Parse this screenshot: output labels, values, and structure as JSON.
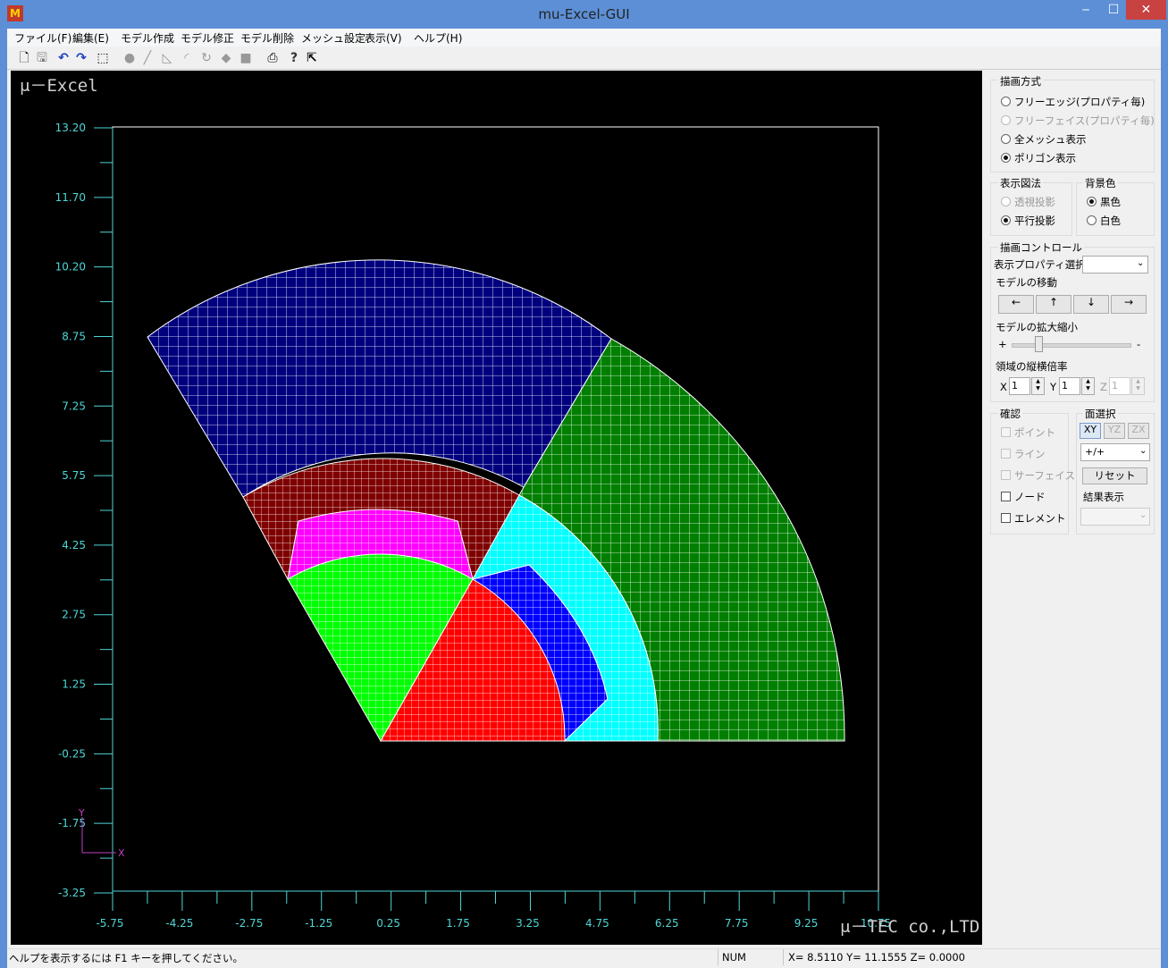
{
  "window": {
    "title": "mu-Excel-GUI",
    "app_icon": "mu-app-icon",
    "min": "‒",
    "max": "☐",
    "close": "✕"
  },
  "menu": [
    "ファイル(F)",
    "編集(E)",
    "モデル作成",
    "モデル修正",
    "モデル削除",
    "メッシュ設定",
    "表示(V)",
    "ヘルプ(H)"
  ],
  "toolbar": [
    "new-file-icon",
    "save-icon",
    "undo-icon",
    "redo-icon",
    "select-rect-icon",
    "point-icon",
    "line-icon",
    "arc-icon",
    "arc2-icon",
    "rotate-icon",
    "surface-icon",
    "fill-icon",
    "print-icon",
    "help-icon",
    "context-help-icon"
  ],
  "viewport": {
    "logo": "μ－Excel",
    "footer": "μ－TEC co.,LTD",
    "axis_x": "X",
    "axis_y": "Y",
    "y_ticks": [
      "13.20",
      "11.70",
      "10.20",
      "8.75",
      "7.25",
      "5.75",
      "4.25",
      "2.75",
      "1.25",
      "-0.25",
      "-1.75",
      "-3.25"
    ],
    "x_ticks": [
      "-5.75",
      "-4.25",
      "-2.75",
      "-1.25",
      "0.25",
      "1.75",
      "3.25",
      "4.75",
      "6.25",
      "7.75",
      "9.25",
      "10.75"
    ],
    "colors": {
      "background": "#000000",
      "axis": "#4fd6d6",
      "mesh": "#ffffff",
      "navy": "#00007f",
      "green": "#007f00",
      "maroon": "#7f0000",
      "magenta": "#ff00ff",
      "lime": "#00ff00",
      "red": "#ff0000",
      "cyan": "#00ffff",
      "blue": "#0000ff"
    }
  },
  "panel": {
    "draw_mode": {
      "title": "描画方式",
      "options": [
        "フリーエッジ(プロパティ毎)",
        "フリーフェイス(プロパティ毎)",
        "全メッシュ表示",
        "ポリゴン表示"
      ],
      "selected": "ポリゴン表示"
    },
    "projection": {
      "title": "表示図法",
      "options": [
        "透視投影",
        "平行投影"
      ],
      "selected": "平行投影"
    },
    "bg": {
      "title": "背景色",
      "options": [
        "黒色",
        "白色"
      ],
      "selected": "黒色"
    },
    "control": {
      "title": "描画コントロール",
      "prop_label": "表示プロパティ選択",
      "move_label": "モデルの移動",
      "move_buttons": [
        "←",
        "↑",
        "↓",
        "→"
      ],
      "zoom_label": "モデルの拡大縮小",
      "zoom_plus": "+",
      "zoom_minus": "-",
      "ratio_label": "領域の縦横倍率",
      "x": "X",
      "x_val": "1",
      "y": "Y",
      "y_val": "1",
      "z": "Z",
      "z_val": "1"
    },
    "confirm": {
      "title": "確認",
      "items": [
        "ポイント",
        "ライン",
        "サーフェイス",
        "ノード",
        "エレメント"
      ]
    },
    "plane": {
      "title": "面選択",
      "buttons": [
        "XY",
        "YZ",
        "ZX"
      ],
      "dir": "+/+",
      "reset": "リセット",
      "result": "結果表示"
    }
  },
  "status": {
    "help": "ヘルプを表示するには F1 キーを押してください。",
    "num": "NUM",
    "coords": "X= 8.5110 Y= 11.1555 Z= 0.0000"
  }
}
